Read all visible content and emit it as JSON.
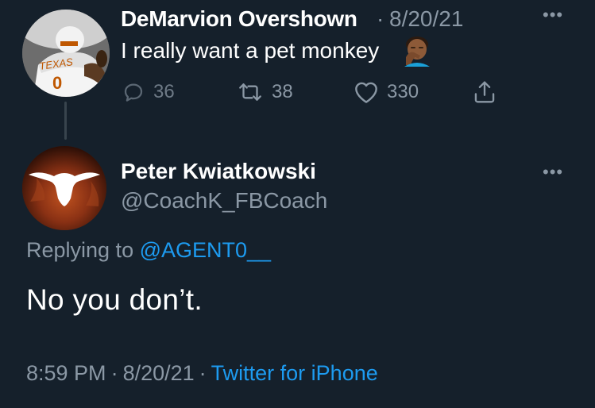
{
  "tweet": {
    "author_name": "DeMarvion Overshown",
    "separator": "·",
    "date": "8/20/21",
    "text": "I really want a pet monkey",
    "emoji": "face-palm-emoji",
    "actions": {
      "reply_count": "36",
      "retweet_count": "38",
      "like_count": "330"
    },
    "avatar_text": "TEXAS"
  },
  "reply": {
    "author_name": "Peter Kwiatkowski",
    "author_handle": "@CoachK_FBCoach",
    "replying_prefix": "Replying to",
    "replying_mention": "@AGENT0__",
    "text": "No you don’t.",
    "time": "8:59 PM",
    "separator": "·",
    "date": "8/20/21",
    "source": "Twitter for iPhone"
  },
  "ui": {
    "more_label": "•••"
  },
  "colors": {
    "background": "#15202b",
    "secondary_text": "#8b98a5",
    "link": "#1d9bf0",
    "thread_line": "#38444d"
  }
}
